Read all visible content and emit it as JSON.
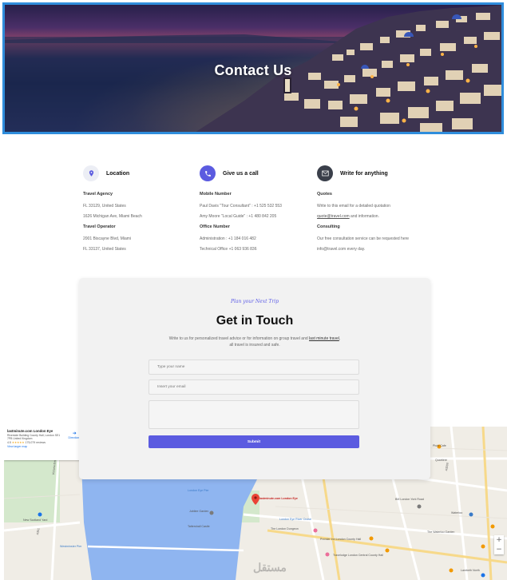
{
  "hero": {
    "title": "Contact Us"
  },
  "columns": [
    {
      "title": "Location",
      "icon": "map-pin-icon",
      "icon_bg": "#eceef5",
      "icon_color": "#5b5be0",
      "groups": [
        {
          "heading": "Travel Agency",
          "lines": [
            "FL 33129, United States",
            "1626 Michigan Ave, Miami Beach"
          ]
        },
        {
          "heading": "Travel Operator",
          "lines": [
            "2001 Biscayne Blvd, Miami",
            "FL 33137, United States"
          ]
        }
      ]
    },
    {
      "title": "Give us a call",
      "icon": "phone-icon",
      "icon_bg": "#5b5be0",
      "icon_color": "#ffffff",
      "groups": [
        {
          "heading": "Mobile Number",
          "lines": [
            "Paul Davis \"Tour Consultant\" : +1 525 532 553",
            "Amy Moore \"Local Guide\" : +1 480 842 205"
          ]
        },
        {
          "heading": "Office Number",
          "lines": [
            "Administration : +1 184 016 482",
            "Technical Office +1 063 936 836"
          ]
        }
      ]
    },
    {
      "title": "Write for anything",
      "icon": "envelope-icon",
      "icon_bg": "#3a3f4a",
      "icon_color": "#ffffff",
      "groups": [
        {
          "heading": "Quotes",
          "lines": [
            "Write to this email for a detailed quotation",
            "quote@travel.com and information."
          ],
          "link": "quote@travel.com"
        },
        {
          "heading": "Consulting",
          "lines": [
            "Our free consultation service can be requested here",
            "info@travel.com every day."
          ]
        }
      ]
    }
  ],
  "form": {
    "script": "Plan your Next Trip",
    "title": "Get in Touch",
    "desc_before": "Write to us for personalized travel advice or for information on group travel and ",
    "desc_link": "last minute travel",
    "desc_after": ", all travel is insured and safe.",
    "name_placeholder": "Type your name",
    "email_placeholder": "Insert your email",
    "message_placeholder": "",
    "submit_label": "Submit"
  },
  "map": {
    "card_title": "lastminute.com London Eye",
    "card_address": "Riverside Building County Hall, London SE1 7PB United Kingdom",
    "rating": "4.5",
    "stars": "★★★★★",
    "reviews": "175,079 reviews",
    "larger_link": "View larger map",
    "directions": "Directions",
    "zoom_in": "+",
    "zoom_out": "−",
    "labels": {
      "eye": "lastminute.com London Eye",
      "pier": "London Eye Pier",
      "river_cruise": "London Eye River Cruise",
      "dungeon": "The London Dungeon",
      "premier_inn": "Premier Inn London County Hall",
      "travelodge": "Travelodge London Central County Hall",
      "garden": "Jubilee Garden",
      "tattershall": "Tattershall Castle",
      "scotland": "New Scotland Yard",
      "westminster": "Westminster Pier",
      "waterloo": "Waterloo",
      "york_road": "BM London York Road",
      "wgc": "The Waterloo Garden",
      "pluto": "Pluto Cafe",
      "quartiere": "Quartiere",
      "victoria": "Victoria Embankment",
      "a3212": "A3212",
      "a3200": "A3200",
      "a301": "A301",
      "lambeth": "Lambeth North"
    }
  },
  "watermark": "مستقل"
}
